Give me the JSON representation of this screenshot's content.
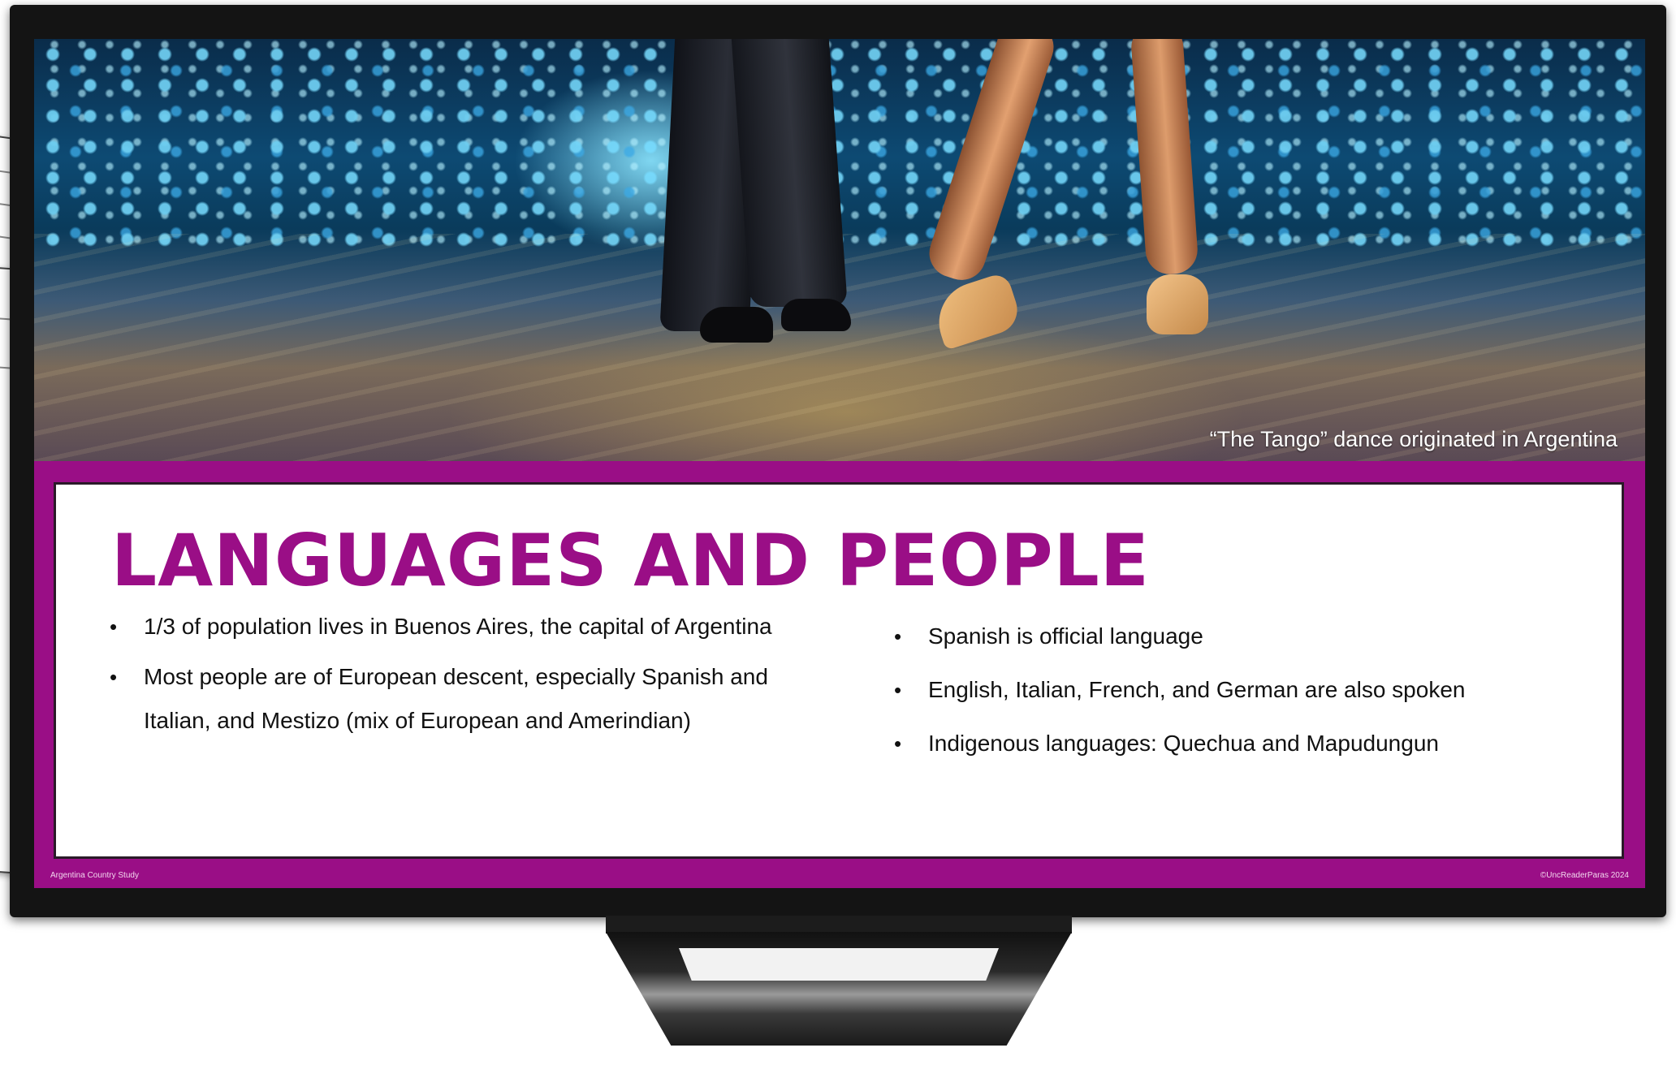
{
  "slide": {
    "caption": "“The Tango” dance originated in Argentina",
    "title": "LANGUAGES AND PEOPLE",
    "left_bullets": [
      "1/3 of population lives in Buenos Aires, the capital of Argentina",
      "Most people are of European descent, especially Spanish and Italian, and Mestizo (mix of European and Amerindian)"
    ],
    "right_bullets": [
      "Spanish is official language",
      "English, Italian, French, and German are also spoken",
      "Indigenous languages: Quechua and Mapudungun"
    ],
    "footer_left": "Argentina Country Study",
    "footer_right": "©UncReaderParas 2024"
  },
  "colors": {
    "accent": "#9a0e86",
    "monitor_frame": "#141414",
    "panel_background": "#ffffff",
    "caption_text": "#ffffff"
  }
}
